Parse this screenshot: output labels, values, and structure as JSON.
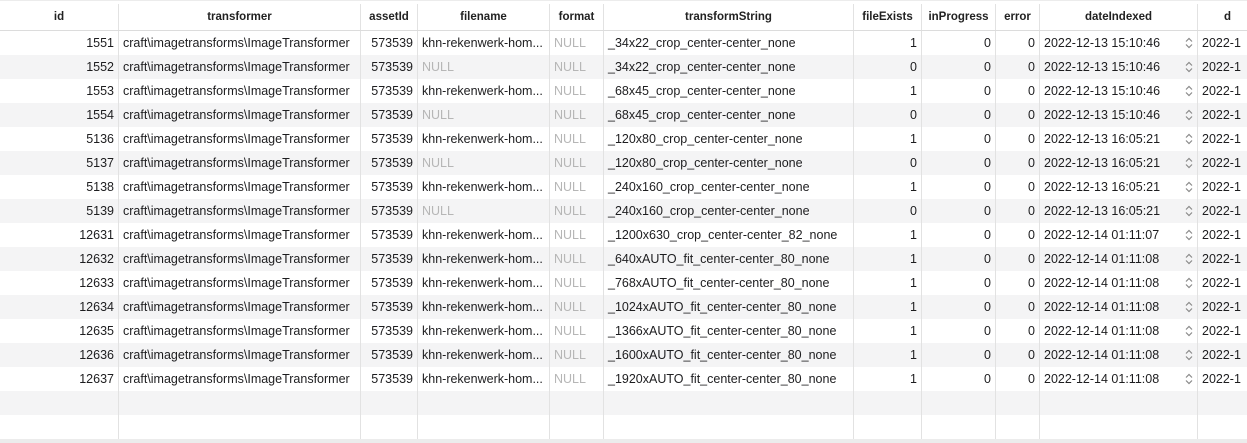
{
  "columns": [
    {
      "key": "id",
      "label": "id"
    },
    {
      "key": "transformer",
      "label": "transformer"
    },
    {
      "key": "assetId",
      "label": "assetId"
    },
    {
      "key": "filename",
      "label": "filename"
    },
    {
      "key": "format",
      "label": "format"
    },
    {
      "key": "transformString",
      "label": "transformString"
    },
    {
      "key": "fileExists",
      "label": "fileExists"
    },
    {
      "key": "inProgress",
      "label": "inProgress"
    },
    {
      "key": "error",
      "label": "error"
    },
    {
      "key": "dateIndexed",
      "label": "dateIndexed"
    },
    {
      "key": "next",
      "label": "d"
    }
  ],
  "rows": [
    {
      "id": "1551",
      "transformer": "craft\\imagetransforms\\ImageTransformer",
      "assetId": "573539",
      "filename": "khn-rekenwerk-hom...",
      "format": "NULL",
      "transformString": "_34x22_crop_center-center_none",
      "fileExists": "1",
      "inProgress": "0",
      "error": "0",
      "dateIndexed": "2022-12-13 15:10:46",
      "next": "2022-1"
    },
    {
      "id": "1552",
      "transformer": "craft\\imagetransforms\\ImageTransformer",
      "assetId": "573539",
      "filename": "NULL",
      "format": "NULL",
      "transformString": "_34x22_crop_center-center_none",
      "fileExists": "0",
      "inProgress": "0",
      "error": "0",
      "dateIndexed": "2022-12-13 15:10:46",
      "next": "2022-1"
    },
    {
      "id": "1553",
      "transformer": "craft\\imagetransforms\\ImageTransformer",
      "assetId": "573539",
      "filename": "khn-rekenwerk-hom...",
      "format": "NULL",
      "transformString": "_68x45_crop_center-center_none",
      "fileExists": "1",
      "inProgress": "0",
      "error": "0",
      "dateIndexed": "2022-12-13 15:10:46",
      "next": "2022-1"
    },
    {
      "id": "1554",
      "transformer": "craft\\imagetransforms\\ImageTransformer",
      "assetId": "573539",
      "filename": "NULL",
      "format": "NULL",
      "transformString": "_68x45_crop_center-center_none",
      "fileExists": "0",
      "inProgress": "0",
      "error": "0",
      "dateIndexed": "2022-12-13 15:10:46",
      "next": "2022-1"
    },
    {
      "id": "5136",
      "transformer": "craft\\imagetransforms\\ImageTransformer",
      "assetId": "573539",
      "filename": "khn-rekenwerk-hom...",
      "format": "NULL",
      "transformString": "_120x80_crop_center-center_none",
      "fileExists": "1",
      "inProgress": "0",
      "error": "0",
      "dateIndexed": "2022-12-13 16:05:21",
      "next": "2022-1"
    },
    {
      "id": "5137",
      "transformer": "craft\\imagetransforms\\ImageTransformer",
      "assetId": "573539",
      "filename": "NULL",
      "format": "NULL",
      "transformString": "_120x80_crop_center-center_none",
      "fileExists": "0",
      "inProgress": "0",
      "error": "0",
      "dateIndexed": "2022-12-13 16:05:21",
      "next": "2022-1"
    },
    {
      "id": "5138",
      "transformer": "craft\\imagetransforms\\ImageTransformer",
      "assetId": "573539",
      "filename": "khn-rekenwerk-hom...",
      "format": "NULL",
      "transformString": "_240x160_crop_center-center_none",
      "fileExists": "1",
      "inProgress": "0",
      "error": "0",
      "dateIndexed": "2022-12-13 16:05:21",
      "next": "2022-1"
    },
    {
      "id": "5139",
      "transformer": "craft\\imagetransforms\\ImageTransformer",
      "assetId": "573539",
      "filename": "NULL",
      "format": "NULL",
      "transformString": "_240x160_crop_center-center_none",
      "fileExists": "0",
      "inProgress": "0",
      "error": "0",
      "dateIndexed": "2022-12-13 16:05:21",
      "next": "2022-1"
    },
    {
      "id": "12631",
      "transformer": "craft\\imagetransforms\\ImageTransformer",
      "assetId": "573539",
      "filename": "khn-rekenwerk-hom...",
      "format": "NULL",
      "transformString": "_1200x630_crop_center-center_82_none",
      "fileExists": "1",
      "inProgress": "0",
      "error": "0",
      "dateIndexed": "2022-12-14 01:11:07",
      "next": "2022-1"
    },
    {
      "id": "12632",
      "transformer": "craft\\imagetransforms\\ImageTransformer",
      "assetId": "573539",
      "filename": "khn-rekenwerk-hom...",
      "format": "NULL",
      "transformString": "_640xAUTO_fit_center-center_80_none",
      "fileExists": "1",
      "inProgress": "0",
      "error": "0",
      "dateIndexed": "2022-12-14 01:11:08",
      "next": "2022-1"
    },
    {
      "id": "12633",
      "transformer": "craft\\imagetransforms\\ImageTransformer",
      "assetId": "573539",
      "filename": "khn-rekenwerk-hom...",
      "format": "NULL",
      "transformString": "_768xAUTO_fit_center-center_80_none",
      "fileExists": "1",
      "inProgress": "0",
      "error": "0",
      "dateIndexed": "2022-12-14 01:11:08",
      "next": "2022-1"
    },
    {
      "id": "12634",
      "transformer": "craft\\imagetransforms\\ImageTransformer",
      "assetId": "573539",
      "filename": "khn-rekenwerk-hom...",
      "format": "NULL",
      "transformString": "_1024xAUTO_fit_center-center_80_none",
      "fileExists": "1",
      "inProgress": "0",
      "error": "0",
      "dateIndexed": "2022-12-14 01:11:08",
      "next": "2022-1"
    },
    {
      "id": "12635",
      "transformer": "craft\\imagetransforms\\ImageTransformer",
      "assetId": "573539",
      "filename": "khn-rekenwerk-hom...",
      "format": "NULL",
      "transformString": "_1366xAUTO_fit_center-center_80_none",
      "fileExists": "1",
      "inProgress": "0",
      "error": "0",
      "dateIndexed": "2022-12-14 01:11:08",
      "next": "2022-1"
    },
    {
      "id": "12636",
      "transformer": "craft\\imagetransforms\\ImageTransformer",
      "assetId": "573539",
      "filename": "khn-rekenwerk-hom...",
      "format": "NULL",
      "transformString": "_1600xAUTO_fit_center-center_80_none",
      "fileExists": "1",
      "inProgress": "0",
      "error": "0",
      "dateIndexed": "2022-12-14 01:11:08",
      "next": "2022-1"
    },
    {
      "id": "12637",
      "transformer": "craft\\imagetransforms\\ImageTransformer",
      "assetId": "573539",
      "filename": "khn-rekenwerk-hom...",
      "format": "NULL",
      "transformString": "_1920xAUTO_fit_center-center_80_none",
      "fileExists": "1",
      "inProgress": "0",
      "error": "0",
      "dateIndexed": "2022-12-14 01:11:08",
      "next": "2022-1"
    }
  ],
  "null_color": "#b6b6b6",
  "stripe_color": "#f4f4f5",
  "stepper_icon": "updown-stepper-icon"
}
